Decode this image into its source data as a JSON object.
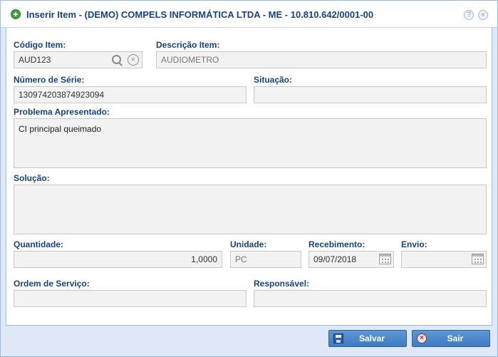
{
  "window": {
    "title": "Inserir Item - (DEMO) COMPELS INFORMÁTICA LTDA - ME - 10.810.642/0001-00",
    "title_icon": "add-circle-icon",
    "controls": [
      "help-icon",
      "close-icon"
    ]
  },
  "form": {
    "codigo_item": {
      "label": "Código Item:",
      "value": "AUD123"
    },
    "descricao_item": {
      "label": "Descrição Item:",
      "value": "AUDIOMETRO"
    },
    "numero_serie": {
      "label": "Número de Série:",
      "value": "130974203874923094"
    },
    "situacao": {
      "label": "Situação:",
      "value": ""
    },
    "problema": {
      "label": "Problema Apresentado:",
      "value": "CI principal queimado"
    },
    "solucao": {
      "label": "Solução:",
      "value": ""
    },
    "quantidade": {
      "label": "Quantidade:",
      "value": "1,0000"
    },
    "unidade": {
      "label": "Unidade:",
      "value": "PC"
    },
    "recebimento": {
      "label": "Recebimento:",
      "value": "09/07/2018"
    },
    "envio": {
      "label": "Envio:",
      "value": ""
    },
    "ordem_servico": {
      "label": "Ordem de Serviço:",
      "value": ""
    },
    "responsavel": {
      "label": "Responsável:",
      "value": ""
    }
  },
  "buttons": {
    "save": {
      "label": "Salvar",
      "icon": "floppy-disk-icon"
    },
    "exit": {
      "label": "Sair",
      "icon": "exit-icon"
    }
  }
}
